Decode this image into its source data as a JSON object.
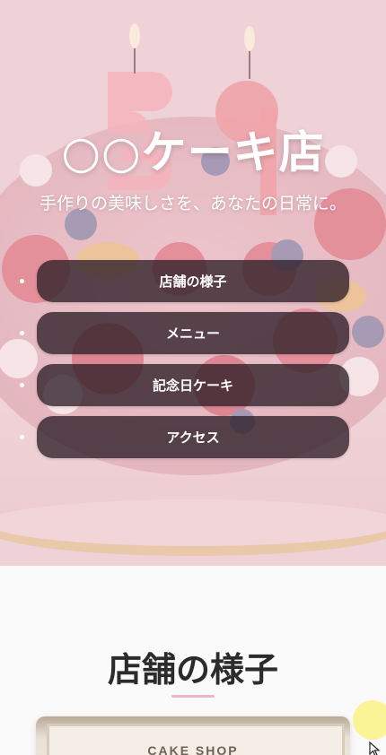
{
  "hero": {
    "title": "○○ケーキ店",
    "tagline": "手作りの美味しさを、あなたの日常に。"
  },
  "nav": {
    "items": [
      {
        "label": "店舗の様子"
      },
      {
        "label": "メニュー"
      },
      {
        "label": "記念日ケーキ"
      },
      {
        "label": "アクセス"
      }
    ]
  },
  "store_section": {
    "title": "店舗の様子",
    "photo_sign": "CAKE SHOP"
  },
  "colors": {
    "nav_button_bg": "#2d1e26",
    "accent_underline": "#efb7c4",
    "hero_tint": "#f5d7de"
  }
}
